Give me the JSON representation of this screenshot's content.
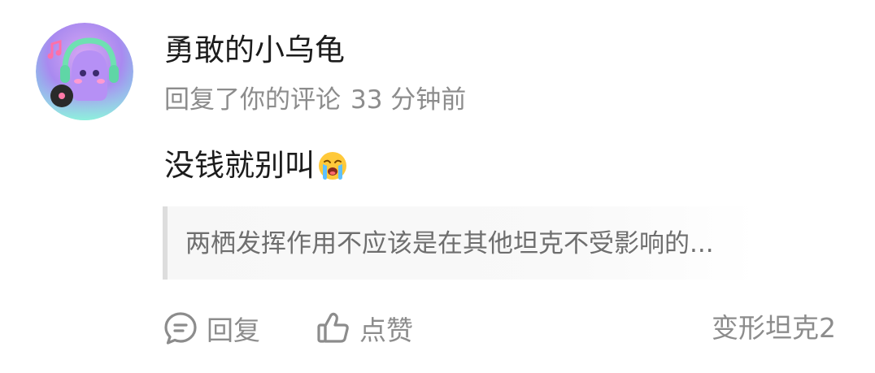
{
  "user": {
    "name": "勇敢的小乌龟",
    "avatar_icon": "purple-creature-headphones-avatar"
  },
  "meta": {
    "action_text": "回复了你的评论",
    "time_ago": "33 分钟前"
  },
  "comment": {
    "text": "没钱就别叫",
    "emoji": "loudly-crying-face-emoji"
  },
  "quote": {
    "text": "两栖发挥作用不应该是在其他坦克不受影响的..."
  },
  "actions": {
    "reply_label": "回复",
    "reply_icon": "comment-bubble-icon",
    "like_label": "点赞",
    "like_icon": "thumbs-up-icon"
  },
  "topic": {
    "label": "变形坦克2"
  },
  "colors": {
    "primary_text": "#1c1c1c",
    "secondary_text": "#8c8c8c",
    "quote_bar": "#dddddd",
    "quote_bg": "#f7f7f7"
  }
}
